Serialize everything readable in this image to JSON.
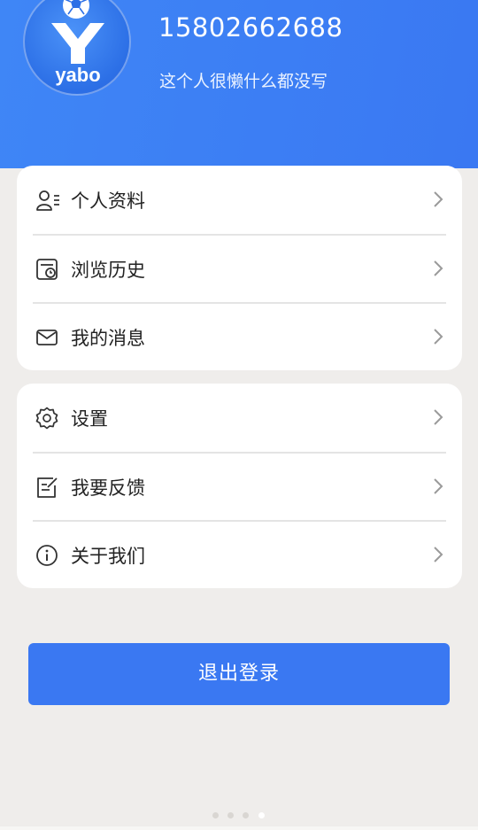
{
  "profile": {
    "phone": "15802662688",
    "bio": "这个人很懒什么都没写",
    "avatar_text": "yabo"
  },
  "menu_group_1": [
    {
      "label": "个人资料",
      "icon": "user-profile-icon"
    },
    {
      "label": "浏览历史",
      "icon": "history-icon"
    },
    {
      "label": "我的消息",
      "icon": "mail-icon"
    }
  ],
  "menu_group_2": [
    {
      "label": "设置",
      "icon": "gear-icon"
    },
    {
      "label": "我要反馈",
      "icon": "feedback-icon"
    },
    {
      "label": "关于我们",
      "icon": "info-icon"
    }
  ],
  "logout_label": "退出登录",
  "page_indicator": {
    "count": 4,
    "active_index": 3
  },
  "colors": {
    "brand_blue": "#3a78f2",
    "page_bg": "#efedeb",
    "card_bg": "#ffffff",
    "text": "#222222",
    "chevron": "#9a9a9a"
  }
}
